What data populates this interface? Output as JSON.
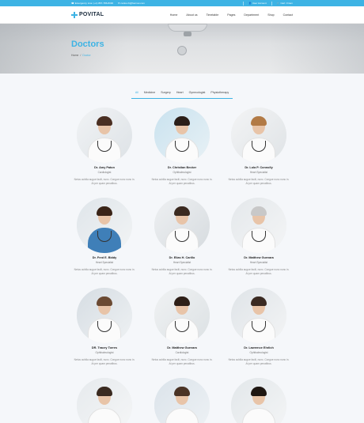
{
  "topbar": {
    "phone": "Emergency Line: (+1) 867-786-8330",
    "email": "carlos.rb@hermet.com",
    "account": "User Account",
    "cart": "Cart: 0 item"
  },
  "header": {
    "logo": "POVITAL",
    "nav": [
      "Home",
      "About us",
      "Timetable",
      "Pages",
      "Department",
      "Shop",
      "Contact"
    ]
  },
  "hero": {
    "title": "Doctors",
    "breadcrumb": [
      "Home",
      "Doctor"
    ]
  },
  "filters": {
    "items": [
      "All",
      "Medicine",
      "Surgery",
      "Heart",
      "Gynecologist",
      "Physiotherapy"
    ],
    "active": "All"
  },
  "doctors": [
    {
      "name": "Dr. Amy Paton",
      "role": "Cardiologist",
      "desc": "Netus cubilia augue facili, nunc. Congue nunc nunc in. At per quam penatibus."
    },
    {
      "name": "Dr. Christian Becker",
      "role": "Ophthalmologist",
      "desc": "Netus cubilia augue facili, nunc. Congue nunc nunc in. At per quam penatibus."
    },
    {
      "name": "Dr. Lola P. Connolly",
      "role": "Heart Specialist",
      "desc": "Netus cubilia augue facili, nunc. Congue nunc nunc in. At per quam penatibus."
    },
    {
      "name": "Dr. Fred E. Biddy",
      "role": "Heart Specialist",
      "desc": "Netus cubilia augue facili, nunc. Congue nunc nunc in. At per quam penatibus."
    },
    {
      "name": "Dr. Elias H. Carillo",
      "role": "Heart Specialist",
      "desc": "Netus cubilia augue facili, nunc. Congue nunc nunc in. At per quam penatibus."
    },
    {
      "name": "Dr. Matthew Guevara",
      "role": "Heart Specialist",
      "desc": "Netus cubilia augue facili, nunc. Congue nunc nunc in. At per quam penatibus."
    },
    {
      "name": "DR. Tracey Torres",
      "role": "Ophthalmologist",
      "desc": "Netus cubilia augue facili, nunc. Congue nunc nunc in. At per quam penatibus."
    },
    {
      "name": "Dr. Matthew Guevara",
      "role": "Cardiologist",
      "desc": "Netus cubilia augue facili, nunc. Congue nunc nunc in. At per quam penatibus."
    },
    {
      "name": "Dr. Lawrence Ehrlich",
      "role": "Ophthalmologist",
      "desc": "Netus cubilia augue facili, nunc. Congue nunc nunc in. At per quam penatibus."
    }
  ],
  "colors": {
    "accent": "#3db3e4",
    "topbar": "#3db3e4"
  }
}
